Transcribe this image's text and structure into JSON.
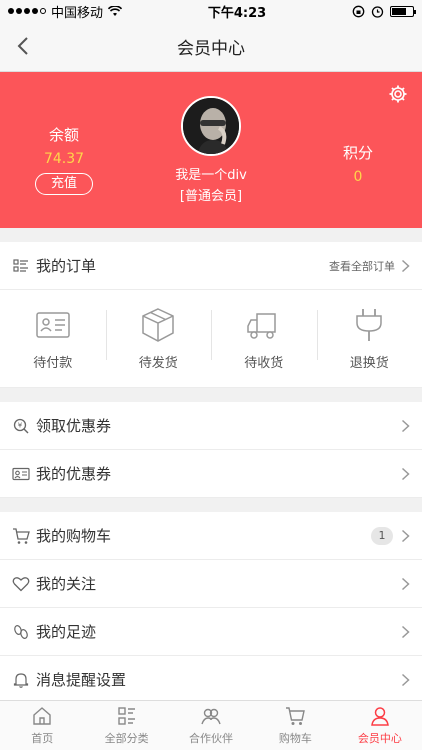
{
  "status_bar": {
    "carrier": "中国移动",
    "time": "下午4:23"
  },
  "nav": {
    "title": "会员中心"
  },
  "profile": {
    "balance_label": "余额",
    "balance_value": "74.37",
    "recharge_label": "充值",
    "username": "我是一个div",
    "level": "[普通会员]",
    "points_label": "积分",
    "points_value": "0"
  },
  "orders": {
    "title": "我的订单",
    "view_all": "查看全部订单",
    "statuses": [
      {
        "label": "待付款",
        "icon": "payment-card-icon"
      },
      {
        "label": "待发货",
        "icon": "package-box-icon"
      },
      {
        "label": "待收货",
        "icon": "delivery-truck-icon"
      },
      {
        "label": "退换货",
        "icon": "plug-icon"
      }
    ]
  },
  "coupons": {
    "items": [
      {
        "label": "领取优惠券",
        "icon": "coupon-search-icon"
      },
      {
        "label": "我的优惠券",
        "icon": "coupon-card-icon"
      }
    ]
  },
  "menu": {
    "items": [
      {
        "label": "我的购物车",
        "icon": "cart-icon",
        "badge": "1"
      },
      {
        "label": "我的关注",
        "icon": "heart-icon"
      },
      {
        "label": "我的足迹",
        "icon": "footprint-icon"
      },
      {
        "label": "消息提醒设置",
        "icon": "bell-icon"
      }
    ]
  },
  "tabbar": {
    "items": [
      {
        "label": "首页",
        "icon": "home-icon"
      },
      {
        "label": "全部分类",
        "icon": "category-icon"
      },
      {
        "label": "合作伙伴",
        "icon": "partners-icon"
      },
      {
        "label": "购物车",
        "icon": "cart-icon"
      },
      {
        "label": "会员中心",
        "icon": "member-icon",
        "active": true
      }
    ]
  },
  "colors": {
    "brand_red": "#fc5559",
    "accent_yellow": "#ffd64a",
    "tab_active": "#fc3d45"
  }
}
